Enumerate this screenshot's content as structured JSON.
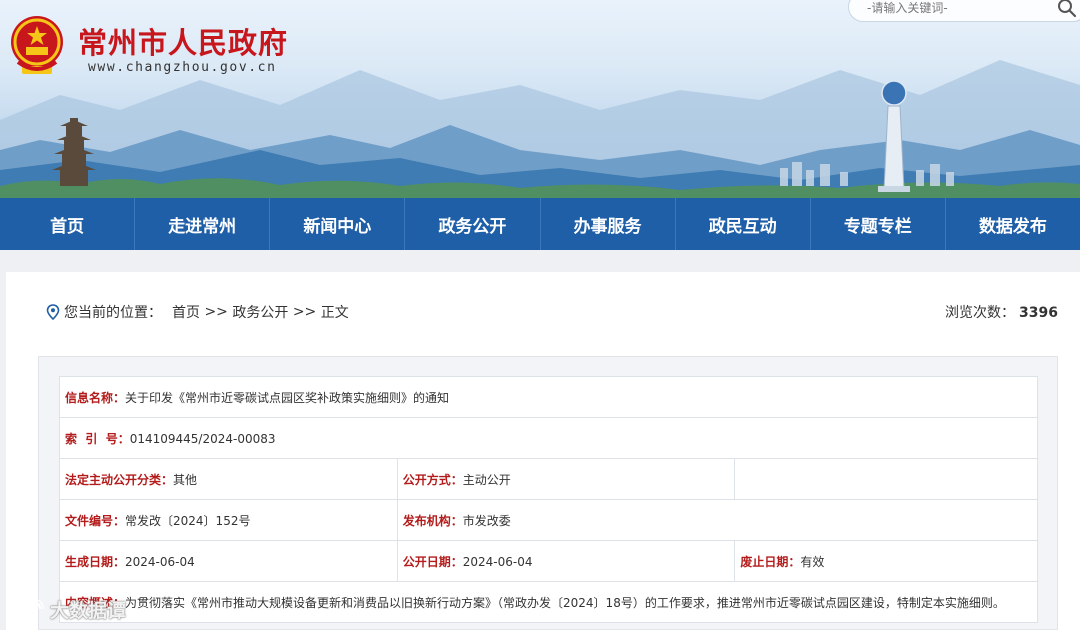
{
  "header": {
    "site_title": "常州市人民政府",
    "site_url": "www.changzhou.gov.cn",
    "search_placeholder": "-请输入关键词-",
    "emblem_icon": "national-emblem-icon",
    "search_icon": "search-icon"
  },
  "nav": {
    "items": [
      {
        "label": "首页"
      },
      {
        "label": "走进常州"
      },
      {
        "label": "新闻中心"
      },
      {
        "label": "政务公开"
      },
      {
        "label": "办事服务"
      },
      {
        "label": "政民互动"
      },
      {
        "label": "专题专栏"
      },
      {
        "label": "数据发布"
      }
    ]
  },
  "breadcrumb": {
    "prefix": "您当前的位置：",
    "items": [
      "首页",
      "政务公开",
      "正文"
    ],
    "separator": " >> ",
    "icon": "location-pin-icon"
  },
  "views": {
    "label": "浏览次数：",
    "count": "3396"
  },
  "info": {
    "title_label": "信息名称：",
    "title_value": "关于印发《常州市近零碳试点园区奖补政策实施细则》的通知",
    "index_label": "索  引  号：",
    "index_value": "014109445/2024-00083",
    "category_label": "法定主动公开分类：",
    "category_value": "其他",
    "method_label": "公开方式：",
    "method_value": "主动公开",
    "docno_label": "文件编号：",
    "docno_value": "常发改〔2024〕152号",
    "issuer_label": "发布机构：",
    "issuer_value": "市发改委",
    "created_label": "生成日期：",
    "created_value": "2024-06-04",
    "published_label": "公开日期：",
    "published_value": "2024-06-04",
    "repeal_label": "废止日期：",
    "repeal_value": "有效",
    "summary_label": "内容概述：",
    "summary_value": "为贯彻落实《常州市推动大规模设备更新和消费品以旧换新行动方案》（常政办发〔2024〕18号）的工作要求，推进常州市近零碳试点园区建设，特制定本实施细则。"
  },
  "watermark": {
    "text": "大数据谭",
    "icon": "weibo-icon"
  },
  "colors": {
    "nav_bg": "#1f5fa8",
    "title_red": "#c8161d",
    "label_red": "#b41c1c"
  }
}
